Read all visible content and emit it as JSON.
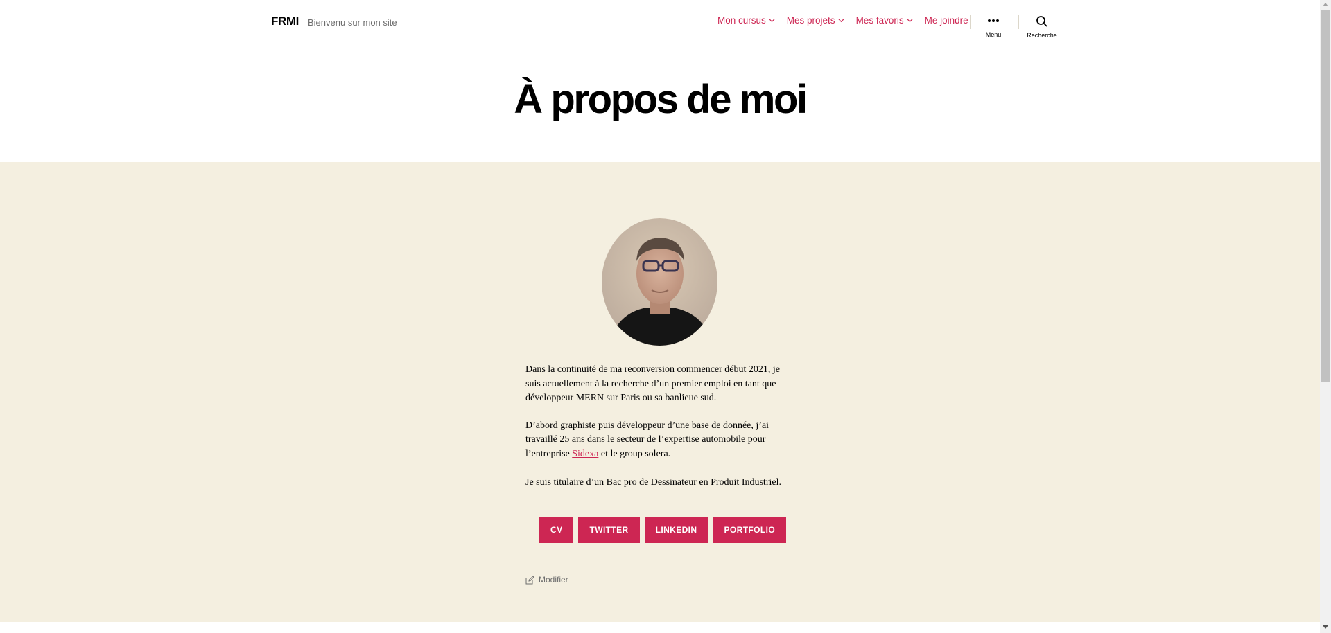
{
  "header": {
    "site_title": "FRMI",
    "site_description": "Bienvenu sur mon site",
    "nav": [
      {
        "label": "Mon cursus",
        "dropdown": true
      },
      {
        "label": "Mes projets",
        "dropdown": true
      },
      {
        "label": "Mes favoris",
        "dropdown": true
      },
      {
        "label": "Me joindre",
        "dropdown": false
      }
    ],
    "menu_label": "Menu",
    "search_label": "Recherche"
  },
  "page": {
    "title": "À propos de moi",
    "paragraph1": "Dans la continuité de ma reconversion commencer début 2021, je suis actuellement à la recherche d’un premier emploi en tant que développeur MERN sur Paris ou sa banlieue sud.",
    "paragraph2_before": "D’abord graphiste puis développeur d’une base de donnée, j’ai travaillé 25 ans dans le secteur de l’expertise automobile pour l’entreprise ",
    "paragraph2_link": "Sidexa",
    "paragraph2_after": " et le group solera.",
    "paragraph3": "Je suis titulaire d’un Bac pro de Dessinateur en Produit Industriel.",
    "buttons": [
      "CV",
      "TWITTER",
      "LINKEDIN",
      "PORTFOLIO"
    ],
    "edit_label": "Modifier"
  },
  "colors": {
    "accent": "#cd2653",
    "section_background": "#f4efe0",
    "secondary_text": "#6d6d6d"
  }
}
